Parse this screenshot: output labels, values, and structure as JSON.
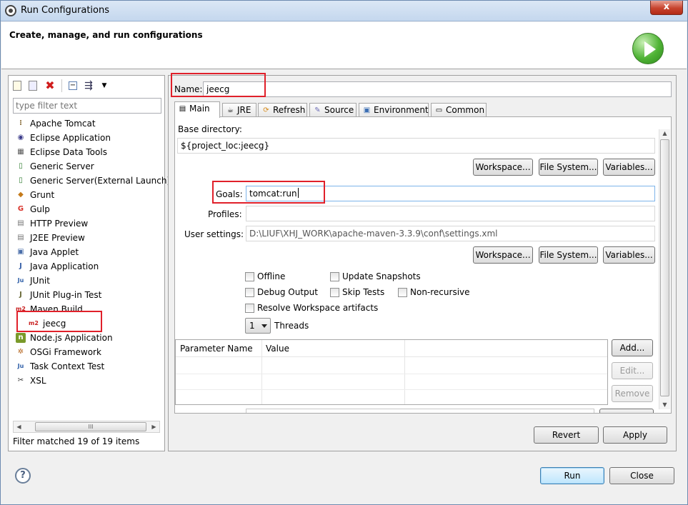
{
  "window": {
    "title": "Run Configurations",
    "close_label": "x"
  },
  "header": {
    "title": "Create, manage, and run configurations"
  },
  "left": {
    "filter_placeholder": "type filter text",
    "items": [
      {
        "label": "Apache Tomcat",
        "icon": "tomcat-icon"
      },
      {
        "label": "Eclipse Application",
        "icon": "eclipse-icon"
      },
      {
        "label": "Eclipse Data Tools",
        "icon": "data-tools-icon"
      },
      {
        "label": "Generic Server",
        "icon": "server-icon"
      },
      {
        "label": "Generic Server(External Launch)",
        "icon": "server-icon"
      },
      {
        "label": "Grunt",
        "icon": "grunt-icon"
      },
      {
        "label": "Gulp",
        "icon": "gulp-icon"
      },
      {
        "label": "HTTP Preview",
        "icon": "preview-icon"
      },
      {
        "label": "J2EE Preview",
        "icon": "preview-icon"
      },
      {
        "label": "Java Applet",
        "icon": "applet-icon"
      },
      {
        "label": "Java Application",
        "icon": "java-app-icon"
      },
      {
        "label": "JUnit",
        "icon": "junit-icon"
      },
      {
        "label": "JUnit Plug-in Test",
        "icon": "junit-plugin-icon"
      },
      {
        "label": "Maven Build",
        "icon": "maven-icon"
      },
      {
        "label": "jeecg",
        "icon": "maven-icon",
        "child": true
      },
      {
        "label": "Node.js Application",
        "icon": "nodejs-icon"
      },
      {
        "label": "OSGi Framework",
        "icon": "osgi-icon"
      },
      {
        "label": "Task Context Test",
        "icon": "task-icon"
      },
      {
        "label": "XSL",
        "icon": "xsl-icon"
      }
    ],
    "status": "Filter matched 19 of 19 items",
    "scroll_thumb": "III"
  },
  "right": {
    "name_label": "Name:",
    "name_value": "jeecg",
    "tabs": [
      {
        "label": "Main",
        "icon": "main-tab-icon"
      },
      {
        "label": "JRE",
        "icon": "jre-tab-icon"
      },
      {
        "label": "Refresh",
        "icon": "refresh-tab-icon"
      },
      {
        "label": "Source",
        "icon": "source-tab-icon"
      },
      {
        "label": "Environment",
        "icon": "environment-tab-icon"
      },
      {
        "label": "Common",
        "icon": "common-tab-icon"
      }
    ],
    "base_directory_label": "Base directory:",
    "base_directory_value": "${project_loc:jeecg}",
    "workspace_label": "Workspace...",
    "filesystem_label": "File System...",
    "variables_label": "Variables...",
    "goals_label": "Goals:",
    "goals_value": "tomcat:run",
    "profiles_label": "Profiles:",
    "profiles_value": "",
    "user_settings_label": "User settings:",
    "user_settings_value": "D:\\LIUF\\XHJ_WORK\\apache-maven-3.3.9\\conf\\settings.xml",
    "checkboxes": {
      "offline": "Offline",
      "update_snapshots": "Update Snapshots",
      "debug_output": "Debug Output",
      "skip_tests": "Skip Tests",
      "non_recursive": "Non-recursive",
      "resolve_workspace": "Resolve Workspace artifacts"
    },
    "threads_value": "1",
    "threads_label": "Threads",
    "table": {
      "col_name": "Parameter Name",
      "col_value": "Value"
    },
    "add_label": "Add...",
    "edit_label": "Edit...",
    "remove_label": "Remove",
    "revert_label": "Revert",
    "apply_label": "Apply"
  },
  "footer": {
    "help_label": "?",
    "run_label": "Run",
    "close_label": "Close"
  },
  "colors": {
    "highlight": "#e0202a",
    "run_green": "#4fb335"
  }
}
